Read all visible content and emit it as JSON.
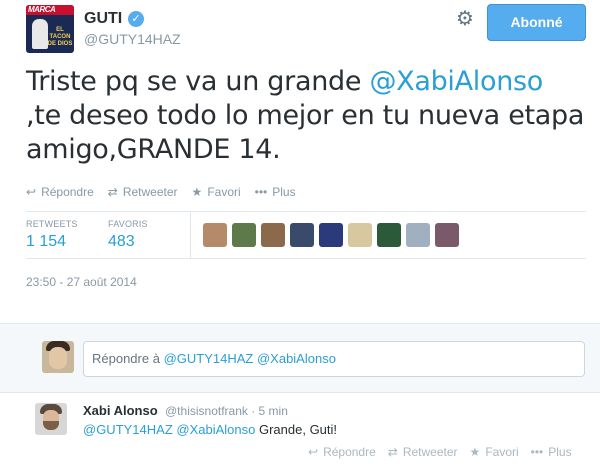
{
  "profile": {
    "name": "GUTI",
    "handle": "@GUTY14HAZ",
    "avatar_brand": "MARCA",
    "avatar_caption": "EL TACON DE DIOS"
  },
  "follow_button": {
    "label": "Abonné"
  },
  "tweet": {
    "text_before": "Triste pq se va un grande ",
    "mention": "@XabiAlonso",
    "text_after": ",te deseo todo lo mejor en tu nueva etapa amigo,GRANDE 14."
  },
  "actions": {
    "reply": "Répondre",
    "retweet": "Retweeter",
    "favorite": "Favori",
    "more": "Plus"
  },
  "stats": {
    "retweets_label": "RETWEETS",
    "retweets_value": "1 154",
    "favorites_label": "FAVORIS",
    "favorites_value": "483"
  },
  "favoriter_avatars": [
    "#b48a6a",
    "#5f7a4a",
    "#8a6a4a",
    "#3a4a6a",
    "#2a3a7a",
    "#d8c8a0",
    "#2a5a3a",
    "#a0b0c0",
    "#7a5a6a"
  ],
  "timestamp": "23:50 - 27 août 2014",
  "reply_box": {
    "prefix": "Répondre à ",
    "mention1": "@GUTY14HAZ",
    "mention2": "@XabiAlonso"
  },
  "reply_tweet": {
    "name": "Xabi Alonso",
    "handle_time": "@thisisnotfrank · 5 min",
    "mention1": "@GUTY14HAZ",
    "mention2": "@XabiAlonso",
    "text": " Grande, Guti!"
  },
  "colors": {
    "accent": "#55acee",
    "link": "#2a9fd6",
    "muted": "#8899a6"
  }
}
